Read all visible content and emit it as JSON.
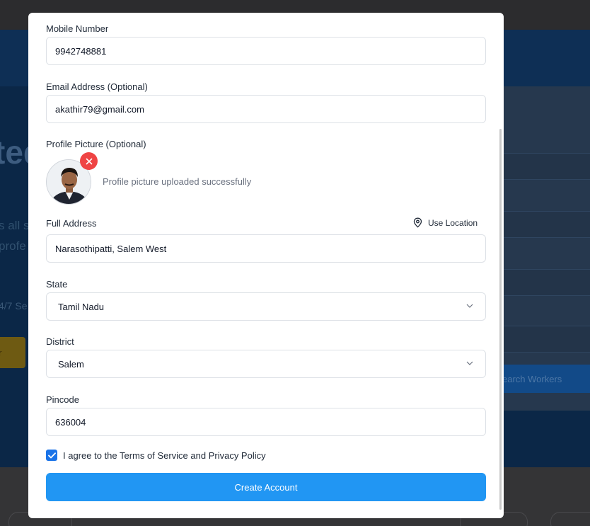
{
  "background": {
    "hero_fragment": "ted",
    "sub_line_1": "s all s",
    "sub_line_2": "profe",
    "small_text": "4/7 Se",
    "yellow_button": "r",
    "search_button": "earch Workers"
  },
  "form": {
    "mobile": {
      "label": "Mobile Number",
      "value": "9942748881"
    },
    "email": {
      "label": "Email Address (Optional)",
      "value": "akathir79@gmail.com"
    },
    "profile": {
      "label": "Profile Picture (Optional)",
      "status": "Profile picture uploaded successfully",
      "remove_icon": "close-icon"
    },
    "address": {
      "label": "Full Address",
      "value": "Narasothipatti, Salem West",
      "use_location_label": "Use Location",
      "use_location_icon": "map-pin-icon"
    },
    "state": {
      "label": "State",
      "value": "Tamil Nadu"
    },
    "district": {
      "label": "District",
      "value": "Salem"
    },
    "pincode": {
      "label": "Pincode",
      "value": "636004"
    },
    "terms": {
      "label": "I agree to the Terms of Service and Privacy Policy",
      "checked": true
    },
    "submit_label": "Create Account"
  },
  "colors": {
    "primary": "#2196f3",
    "checkbox": "#1a73e8",
    "remove": "#ef4444"
  }
}
